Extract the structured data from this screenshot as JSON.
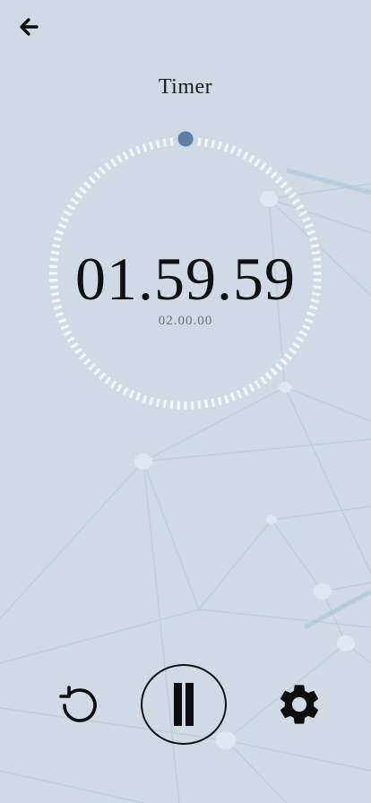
{
  "header": {
    "title": "Timer",
    "back_icon": "arrow-left-icon"
  },
  "timer": {
    "remaining": "01.59.59",
    "total": "02.00.00",
    "progress_fraction": 0.0001
  },
  "controls": {
    "reset_icon": "reset-icon",
    "pause_icon": "pause-icon",
    "settings_icon": "gear-icon"
  },
  "colors": {
    "background": "#cfdae6",
    "ring": "#f3f4f6",
    "knob": "#5b7fa6",
    "text": "#111111"
  }
}
